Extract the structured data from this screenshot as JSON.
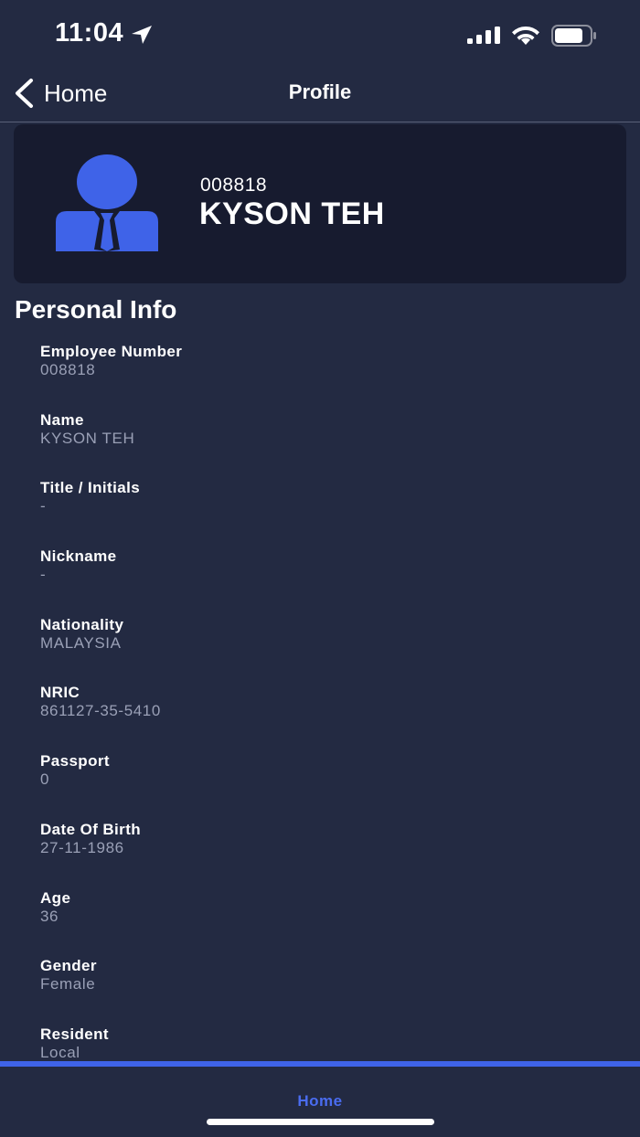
{
  "status_bar": {
    "time": "11:04",
    "icons": [
      "location-arrow-icon",
      "cellular-signal-icon",
      "wifi-icon",
      "battery-icon"
    ]
  },
  "nav": {
    "back_label": "Home",
    "title": "Profile"
  },
  "profile": {
    "employee_id": "008818",
    "name": "KYSON TEH",
    "avatar_icon": "person-avatar-icon",
    "accent_color": "#3f63e8"
  },
  "personal_info": {
    "title": "Personal Info",
    "items": [
      {
        "label": "Employee Number",
        "value": "008818"
      },
      {
        "label": "Name",
        "value": "KYSON TEH"
      },
      {
        "label": "Title / Initials",
        "value": "-"
      },
      {
        "label": "Nickname",
        "value": "-"
      },
      {
        "label": "Nationality",
        "value": "MALAYSIA"
      },
      {
        "label": "NRIC",
        "value": "861127-35-5410"
      },
      {
        "label": "Passport",
        "value": "0"
      },
      {
        "label": "Date Of Birth",
        "value": "27-11-1986"
      },
      {
        "label": "Age",
        "value": "36"
      },
      {
        "label": "Gender",
        "value": "Female"
      },
      {
        "label": "Resident",
        "value": "Local"
      }
    ]
  },
  "tab_bar": {
    "home_label": "Home",
    "active_color": "#4a6cf0"
  }
}
